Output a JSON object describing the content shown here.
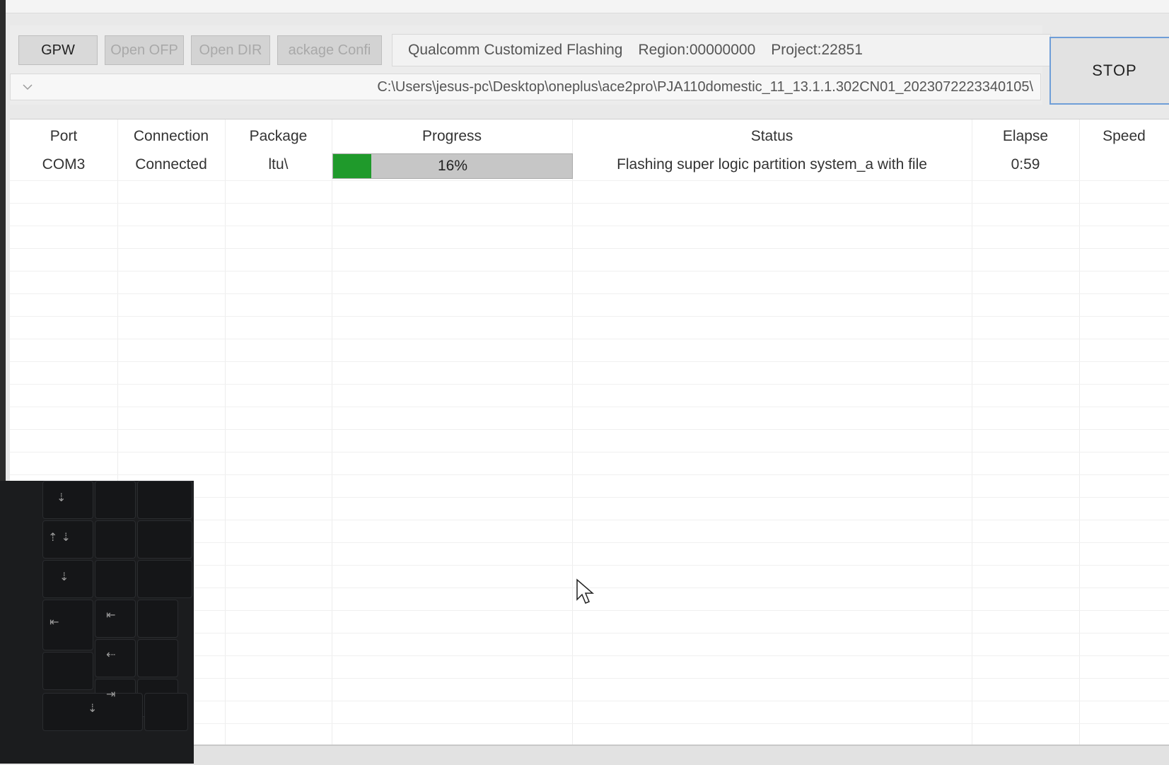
{
  "toolbar": {
    "buttons": [
      {
        "label": "GPW",
        "enabled": true
      },
      {
        "label": "Open OFP",
        "enabled": false
      },
      {
        "label": "Open DIR",
        "enabled": false
      },
      {
        "label": "ackage Confi",
        "enabled": false
      }
    ],
    "mode_text": "Qualcomm Customized Flashing",
    "region_text": "Region:00000000",
    "project_text": "Project:22851",
    "path_value": "C:\\Users\\jesus-pc\\Desktop\\oneplus\\ace2pro\\PJA110domestic_11_13.1.1.302CN01_2023072223340105\\",
    "stop_label": "STOP"
  },
  "table": {
    "columns": [
      "Port",
      "Connection",
      "Package",
      "Progress",
      "Status",
      "Elapse",
      "Speed"
    ],
    "rows": [
      {
        "port": "COM3",
        "connection": "Connected",
        "package": "ltu\\",
        "progress_label": "16%",
        "progress_value": 0.16,
        "status": "Flashing super logic partition system_a with file",
        "elapse": "0:59",
        "speed": ""
      }
    ]
  },
  "colors": {
    "progress_fill": "#1f9a2b",
    "stop_border": "#6f9ed8"
  },
  "icons": {
    "dropdown": "chevron-down-icon",
    "cursor": "mouse-pointer-icon"
  }
}
